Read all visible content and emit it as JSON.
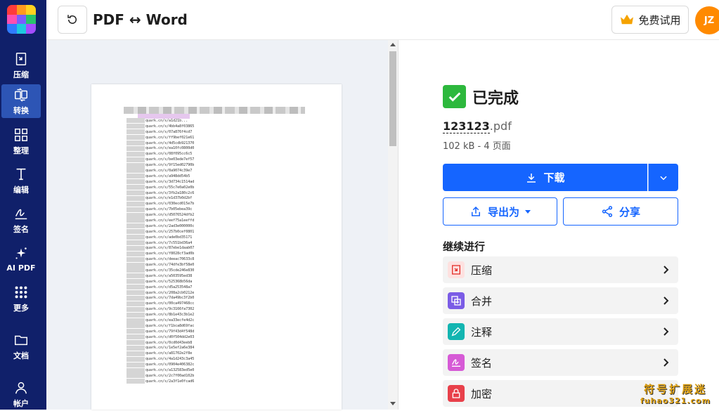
{
  "nav": {
    "items": [
      {
        "label": "压缩",
        "icon": "compress-icon"
      },
      {
        "label": "转换",
        "icon": "convert-icon"
      },
      {
        "label": "整理",
        "icon": "organize-icon"
      },
      {
        "label": "编辑",
        "icon": "edit-text-icon"
      },
      {
        "label": "签名",
        "icon": "sign-icon"
      },
      {
        "label": "AI PDF",
        "icon": "sparkle-icon"
      },
      {
        "label": "更多",
        "icon": "grid-icon"
      },
      {
        "label": "文档",
        "icon": "folder-icon"
      },
      {
        "label": "帐户",
        "icon": "user-icon"
      }
    ],
    "active_index": 1
  },
  "header": {
    "title": "PDF ↔ Word",
    "trial_label": "免费试用",
    "avatar_initials": "JZ"
  },
  "preview": {
    "link_lines": [
      "quark.cn/s/a1d21b...",
      "quark.cn/s/4bb4a8f03865",
      "quark.cn/s/07a876f4cd7",
      "quark.cn/s/ff9bef021e61",
      "quark.cn/s/4d5cdb921370",
      "quark.cn/s/ea10fc0800d0",
      "quark.cn/s/08f095cc6c5",
      "quark.cn/s/be03ede7ef57",
      "quark.cn/s/9f15ed02790b",
      "quark.cn/s/0a9074c39e7",
      "quark.cn/s/a948dd54b5",
      "quark.cn/s/3d734c1514ad",
      "quark.cn/s/55c7e0a02e0b",
      "quark.cn/s/3fb2a180c2c6",
      "quark.cn/s/e1d37b0d2bf",
      "quark.cn/s/030ecd015e7b",
      "quark.cn/s/7b05ebea39c",
      "quark.cn/s/d5076524dfb2",
      "quark.cn/s/eef75a1eeffd",
      "quark.cn/s/2ad3e000000c",
      "quark.cn/s/257b0cef0801",
      "quark.cn/s/ade0bd35171",
      "quark.cn/s/7c551bd36a4",
      "quark.cn/s/87ebe1daab07",
      "quark.cn/s/f8028cf3ad0b",
      "quark.cn/s/deeac70633c8",
      "quark.cn/s/74dfe3bf58e0",
      "quark.cn/s/35cde246e830",
      "quark.cn/s/a503595ed38",
      "quark.cn/s/525368b56da",
      "quark.cn/s/d5a253548a7",
      "quark.cn/s/208a2cb0212e",
      "quark.cn/s/7da49bc3f2b0",
      "quark.cn/s/00ca497468cc",
      "quark.cn/s/9c3166fa7302",
      "quark.cn/s/8b1e43c3b1e2",
      "quark.cn/s/ea33ecfe4d2c",
      "quark.cn/s/f1bca8d69fac",
      "quark.cn/s/79f43d4f548d",
      "quark.cn/s/d0f504dd2e03",
      "quark.cn/s/0cd0d43eeb8",
      "quark.cn/s/1e5ef2a6e384",
      "quark.cn/s/a81702e2f8e",
      "quark.cn/s/4a1d243c3a45",
      "quark.cn/s/0904e406382c",
      "quark.cn/s/a132583ed5e0",
      "quark.cn/s/2c7f00ad102b",
      "quark.cn/s/2a3f1e0fcad6"
    ]
  },
  "result": {
    "status": "已完成",
    "file_base": "123123",
    "file_ext": ".pdf",
    "file_meta": "102 kB - 4 页面",
    "download_label": "下载",
    "export_label": "导出为",
    "share_label": "分享",
    "continue_heading": "继续进行",
    "tools": [
      {
        "label": "压缩",
        "icon": "compress-icon",
        "color": "#e5322d"
      },
      {
        "label": "合并",
        "icon": "merge-icon",
        "color": "#7b5ce6"
      },
      {
        "label": "注释",
        "icon": "annotate-icon",
        "color": "#13b5b1"
      },
      {
        "label": "签名",
        "icon": "sign-icon",
        "color": "#d65ad6"
      },
      {
        "label": "加密",
        "icon": "lock-icon",
        "color": "#e8404a"
      }
    ]
  },
  "watermark": {
    "line1": "符号扩展迷",
    "line2": "fuhao321.com"
  },
  "colors": {
    "rail": "#10206a",
    "rail_active": "#2d55b5",
    "primary": "#1565ff",
    "success": "#2db83d",
    "avatar": "#ff8a00"
  }
}
